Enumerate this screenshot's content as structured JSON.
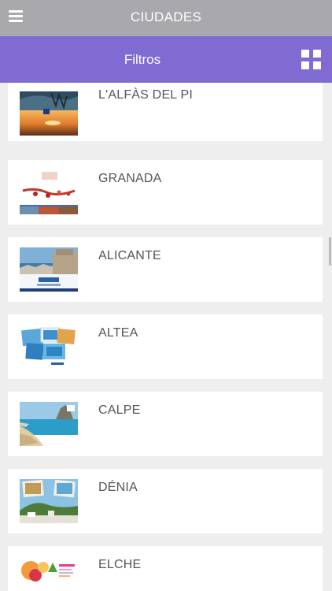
{
  "header": {
    "title": "CIUDADES",
    "menu_icon": "hamburger-menu-icon"
  },
  "filterbar": {
    "label": "Filtros",
    "grid_icon": "grid-view-icon"
  },
  "colors": {
    "header_bg": "#a8a8ad",
    "filterbar_bg": "#7f6bd2",
    "card_bg": "#ffffff",
    "page_bg": "#eeeeee",
    "text": "#555555"
  },
  "cities": [
    {
      "name": "L'ALFÀS DEL PI"
    },
    {
      "name": "GRANADA"
    },
    {
      "name": "ALICANTE"
    },
    {
      "name": "ALTEA"
    },
    {
      "name": "CALPE"
    },
    {
      "name": "DÉNIA"
    },
    {
      "name": "ELCHE"
    }
  ]
}
